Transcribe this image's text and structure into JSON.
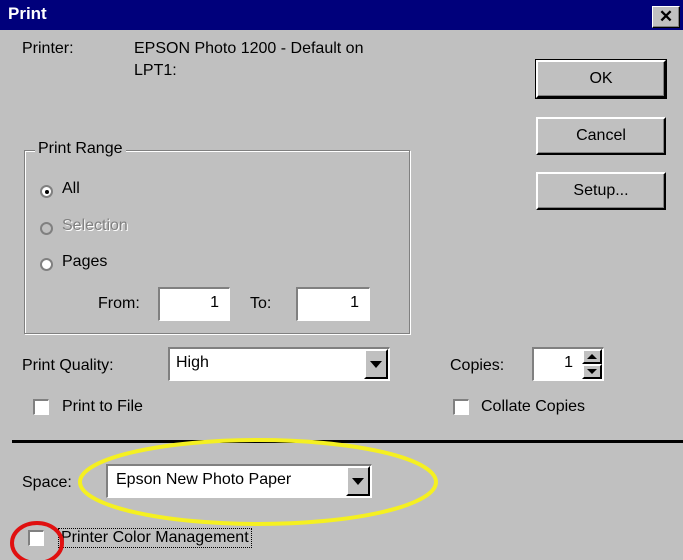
{
  "window": {
    "title": "Print",
    "close_glyph": "✕"
  },
  "printer": {
    "label": "Printer:",
    "name_line1": "EPSON Photo 1200 - Default on",
    "name_line2": "LPT1:"
  },
  "buttons": {
    "ok": "OK",
    "cancel": "Cancel",
    "setup": "Setup..."
  },
  "print_range": {
    "label": "Print Range",
    "all": "All",
    "selection": "Selection",
    "pages": "Pages",
    "selected": "all",
    "from_label": "From:",
    "from_value": "1",
    "to_label": "To:",
    "to_value": "1"
  },
  "quality": {
    "label": "Print Quality:",
    "value": "High"
  },
  "copies": {
    "label": "Copies:",
    "value": "1"
  },
  "print_to_file": {
    "label": "Print to File",
    "checked": false
  },
  "collate": {
    "label": "Collate Copies",
    "checked": false
  },
  "space": {
    "label": "Space:",
    "value": "Epson New Photo Paper"
  },
  "color_management": {
    "label": "Printer Color Management",
    "checked": false
  },
  "annotations": {
    "yellow": "#f5f021",
    "red": "#e01010"
  }
}
